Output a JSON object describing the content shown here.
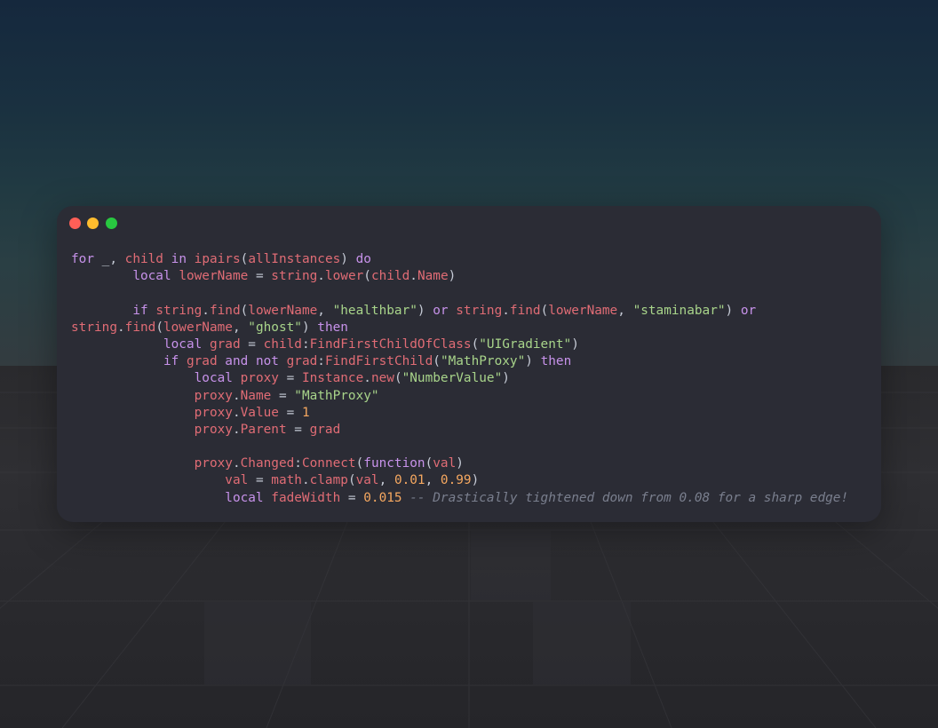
{
  "window": {
    "controls": [
      "close",
      "minimize",
      "maximize"
    ],
    "colors": {
      "close": "#ff5f57",
      "minimize": "#febc2e",
      "maximize": "#28c840",
      "background": "#2b2c35"
    }
  },
  "syntax_colors": {
    "keyword": "#c792ea",
    "identifier": "#e06c75",
    "string": "#a8d48a",
    "number": "#f6a860",
    "operator": "#c6cbd6",
    "comment": "#7a7f8e"
  },
  "code_lines": [
    [
      [
        "kw",
        "for"
      ],
      [
        "op",
        " _, "
      ],
      [
        "id",
        "child"
      ],
      [
        "op",
        " "
      ],
      [
        "kw",
        "in"
      ],
      [
        "op",
        " "
      ],
      [
        "fn",
        "ipairs"
      ],
      [
        "punc",
        "("
      ],
      [
        "id",
        "allInstances"
      ],
      [
        "punc",
        ")"
      ],
      [
        "op",
        " "
      ],
      [
        "kw",
        "do"
      ]
    ],
    [
      [
        "op",
        "        "
      ],
      [
        "kw",
        "local"
      ],
      [
        "op",
        " "
      ],
      [
        "id",
        "lowerName"
      ],
      [
        "op",
        " = "
      ],
      [
        "id",
        "string"
      ],
      [
        "punc",
        "."
      ],
      [
        "fn",
        "lower"
      ],
      [
        "punc",
        "("
      ],
      [
        "id",
        "child"
      ],
      [
        "punc",
        "."
      ],
      [
        "id",
        "Name"
      ],
      [
        "punc",
        ")"
      ]
    ],
    [],
    [
      [
        "op",
        "        "
      ],
      [
        "kw",
        "if"
      ],
      [
        "op",
        " "
      ],
      [
        "id",
        "string"
      ],
      [
        "punc",
        "."
      ],
      [
        "fn",
        "find"
      ],
      [
        "punc",
        "("
      ],
      [
        "id",
        "lowerName"
      ],
      [
        "punc",
        ", "
      ],
      [
        "str",
        "\"healthbar\""
      ],
      [
        "punc",
        ")"
      ],
      [
        "op",
        " "
      ],
      [
        "kw",
        "or"
      ],
      [
        "op",
        " "
      ],
      [
        "id",
        "string"
      ],
      [
        "punc",
        "."
      ],
      [
        "fn",
        "find"
      ],
      [
        "punc",
        "("
      ],
      [
        "id",
        "lowerName"
      ],
      [
        "punc",
        ", "
      ],
      [
        "str",
        "\"staminabar\""
      ],
      [
        "punc",
        ")"
      ],
      [
        "op",
        " "
      ],
      [
        "kw",
        "or"
      ]
    ],
    [
      [
        "id",
        "string"
      ],
      [
        "punc",
        "."
      ],
      [
        "fn",
        "find"
      ],
      [
        "punc",
        "("
      ],
      [
        "id",
        "lowerName"
      ],
      [
        "punc",
        ", "
      ],
      [
        "str",
        "\"ghost\""
      ],
      [
        "punc",
        ")"
      ],
      [
        "op",
        " "
      ],
      [
        "kw",
        "then"
      ]
    ],
    [
      [
        "op",
        "            "
      ],
      [
        "kw",
        "local"
      ],
      [
        "op",
        " "
      ],
      [
        "id",
        "grad"
      ],
      [
        "op",
        " = "
      ],
      [
        "id",
        "child"
      ],
      [
        "punc",
        ":"
      ],
      [
        "fn",
        "FindFirstChildOfClass"
      ],
      [
        "punc",
        "("
      ],
      [
        "str",
        "\"UIGradient\""
      ],
      [
        "punc",
        ")"
      ]
    ],
    [
      [
        "op",
        "            "
      ],
      [
        "kw",
        "if"
      ],
      [
        "op",
        " "
      ],
      [
        "id",
        "grad"
      ],
      [
        "op",
        " "
      ],
      [
        "kw",
        "and"
      ],
      [
        "op",
        " "
      ],
      [
        "kw",
        "not"
      ],
      [
        "op",
        " "
      ],
      [
        "id",
        "grad"
      ],
      [
        "punc",
        ":"
      ],
      [
        "fn",
        "FindFirstChild"
      ],
      [
        "punc",
        "("
      ],
      [
        "str",
        "\"MathProxy\""
      ],
      [
        "punc",
        ")"
      ],
      [
        "op",
        " "
      ],
      [
        "kw",
        "then"
      ]
    ],
    [
      [
        "op",
        "                "
      ],
      [
        "kw",
        "local"
      ],
      [
        "op",
        " "
      ],
      [
        "id",
        "proxy"
      ],
      [
        "op",
        " = "
      ],
      [
        "id",
        "Instance"
      ],
      [
        "punc",
        "."
      ],
      [
        "fn",
        "new"
      ],
      [
        "punc",
        "("
      ],
      [
        "str",
        "\"NumberValue\""
      ],
      [
        "punc",
        ")"
      ]
    ],
    [
      [
        "op",
        "                "
      ],
      [
        "id",
        "proxy"
      ],
      [
        "punc",
        "."
      ],
      [
        "id",
        "Name"
      ],
      [
        "op",
        " = "
      ],
      [
        "str",
        "\"MathProxy\""
      ]
    ],
    [
      [
        "op",
        "                "
      ],
      [
        "id",
        "proxy"
      ],
      [
        "punc",
        "."
      ],
      [
        "id",
        "Value"
      ],
      [
        "op",
        " = "
      ],
      [
        "num",
        "1"
      ]
    ],
    [
      [
        "op",
        "                "
      ],
      [
        "id",
        "proxy"
      ],
      [
        "punc",
        "."
      ],
      [
        "id",
        "Parent"
      ],
      [
        "op",
        " = "
      ],
      [
        "id",
        "grad"
      ]
    ],
    [],
    [
      [
        "op",
        "                "
      ],
      [
        "id",
        "proxy"
      ],
      [
        "punc",
        "."
      ],
      [
        "id",
        "Changed"
      ],
      [
        "punc",
        ":"
      ],
      [
        "fn",
        "Connect"
      ],
      [
        "punc",
        "("
      ],
      [
        "kw",
        "function"
      ],
      [
        "punc",
        "("
      ],
      [
        "id",
        "val"
      ],
      [
        "punc",
        ")"
      ]
    ],
    [
      [
        "op",
        "                    "
      ],
      [
        "id",
        "val"
      ],
      [
        "op",
        " = "
      ],
      [
        "id",
        "math"
      ],
      [
        "punc",
        "."
      ],
      [
        "fn",
        "clamp"
      ],
      [
        "punc",
        "("
      ],
      [
        "id",
        "val"
      ],
      [
        "punc",
        ", "
      ],
      [
        "num",
        "0.01"
      ],
      [
        "punc",
        ", "
      ],
      [
        "num",
        "0.99"
      ],
      [
        "punc",
        ")"
      ]
    ],
    [
      [
        "op",
        "                    "
      ],
      [
        "kw",
        "local"
      ],
      [
        "op",
        " "
      ],
      [
        "id",
        "fadeWidth"
      ],
      [
        "op",
        " = "
      ],
      [
        "num",
        "0.015"
      ],
      [
        "op",
        " "
      ],
      [
        "cm",
        "-- Drastically tightened down from 0.08 for a sharp edge!"
      ]
    ]
  ]
}
